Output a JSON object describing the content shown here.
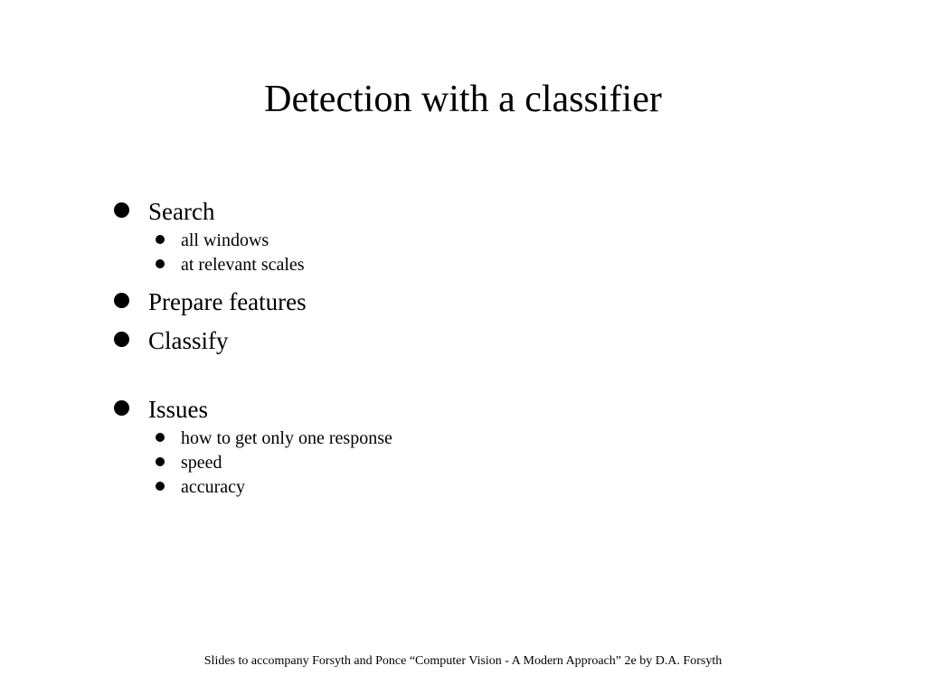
{
  "title": "Detection with a classifier",
  "bullets": {
    "b1": {
      "label": "Search",
      "sub": {
        "s1": "all windows",
        "s2": "at relevant scales"
      }
    },
    "b2": {
      "label": "Prepare features"
    },
    "b3": {
      "label": "Classify"
    },
    "b4": {
      "label": "Issues",
      "sub": {
        "s1": "how to get only one response",
        "s2": "speed",
        "s3": "accuracy"
      }
    }
  },
  "footer": "Slides to accompany Forsyth and Ponce “Computer Vision - A Modern Approach” 2e by D.A. Forsyth"
}
